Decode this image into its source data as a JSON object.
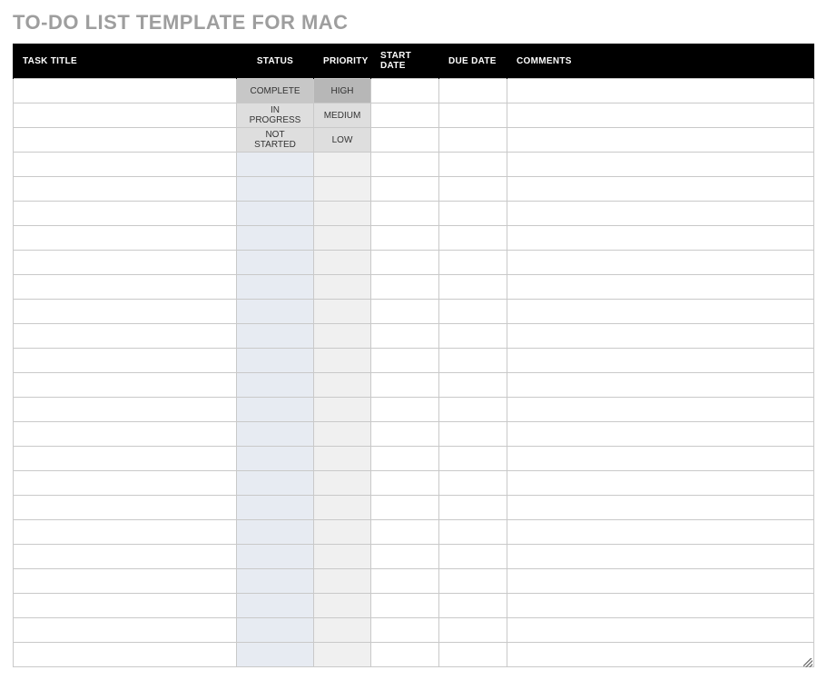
{
  "title": "TO-DO LIST TEMPLATE FOR MAC",
  "columns": {
    "task_title": "TASK TITLE",
    "status": "STATUS",
    "priority": "PRIORITY",
    "start_date": "START DATE",
    "due_date": "DUE DATE",
    "comments": "COMMENTS"
  },
  "status_options": [
    "COMPLETE",
    "IN PROGRESS",
    "NOT STARTED"
  ],
  "priority_options": [
    "HIGH",
    "MEDIUM",
    "LOW"
  ],
  "rows": [
    {
      "task_title": "",
      "status": "COMPLETE",
      "priority": "HIGH",
      "start_date": "",
      "due_date": "",
      "comments": ""
    },
    {
      "task_title": "",
      "status": "IN PROGRESS",
      "priority": "MEDIUM",
      "start_date": "",
      "due_date": "",
      "comments": ""
    },
    {
      "task_title": "",
      "status": "NOT STARTED",
      "priority": "LOW",
      "start_date": "",
      "due_date": "",
      "comments": ""
    },
    {
      "task_title": "",
      "status": "",
      "priority": "",
      "start_date": "",
      "due_date": "",
      "comments": ""
    },
    {
      "task_title": "",
      "status": "",
      "priority": "",
      "start_date": "",
      "due_date": "",
      "comments": ""
    },
    {
      "task_title": "",
      "status": "",
      "priority": "",
      "start_date": "",
      "due_date": "",
      "comments": ""
    },
    {
      "task_title": "",
      "status": "",
      "priority": "",
      "start_date": "",
      "due_date": "",
      "comments": ""
    },
    {
      "task_title": "",
      "status": "",
      "priority": "",
      "start_date": "",
      "due_date": "",
      "comments": ""
    },
    {
      "task_title": "",
      "status": "",
      "priority": "",
      "start_date": "",
      "due_date": "",
      "comments": ""
    },
    {
      "task_title": "",
      "status": "",
      "priority": "",
      "start_date": "",
      "due_date": "",
      "comments": ""
    },
    {
      "task_title": "",
      "status": "",
      "priority": "",
      "start_date": "",
      "due_date": "",
      "comments": ""
    },
    {
      "task_title": "",
      "status": "",
      "priority": "",
      "start_date": "",
      "due_date": "",
      "comments": ""
    },
    {
      "task_title": "",
      "status": "",
      "priority": "",
      "start_date": "",
      "due_date": "",
      "comments": ""
    },
    {
      "task_title": "",
      "status": "",
      "priority": "",
      "start_date": "",
      "due_date": "",
      "comments": ""
    },
    {
      "task_title": "",
      "status": "",
      "priority": "",
      "start_date": "",
      "due_date": "",
      "comments": ""
    },
    {
      "task_title": "",
      "status": "",
      "priority": "",
      "start_date": "",
      "due_date": "",
      "comments": ""
    },
    {
      "task_title": "",
      "status": "",
      "priority": "",
      "start_date": "",
      "due_date": "",
      "comments": ""
    },
    {
      "task_title": "",
      "status": "",
      "priority": "",
      "start_date": "",
      "due_date": "",
      "comments": ""
    },
    {
      "task_title": "",
      "status": "",
      "priority": "",
      "start_date": "",
      "due_date": "",
      "comments": ""
    },
    {
      "task_title": "",
      "status": "",
      "priority": "",
      "start_date": "",
      "due_date": "",
      "comments": ""
    },
    {
      "task_title": "",
      "status": "",
      "priority": "",
      "start_date": "",
      "due_date": "",
      "comments": ""
    },
    {
      "task_title": "",
      "status": "",
      "priority": "",
      "start_date": "",
      "due_date": "",
      "comments": ""
    },
    {
      "task_title": "",
      "status": "",
      "priority": "",
      "start_date": "",
      "due_date": "",
      "comments": ""
    },
    {
      "task_title": "",
      "status": "",
      "priority": "",
      "start_date": "",
      "due_date": "",
      "comments": ""
    }
  ]
}
